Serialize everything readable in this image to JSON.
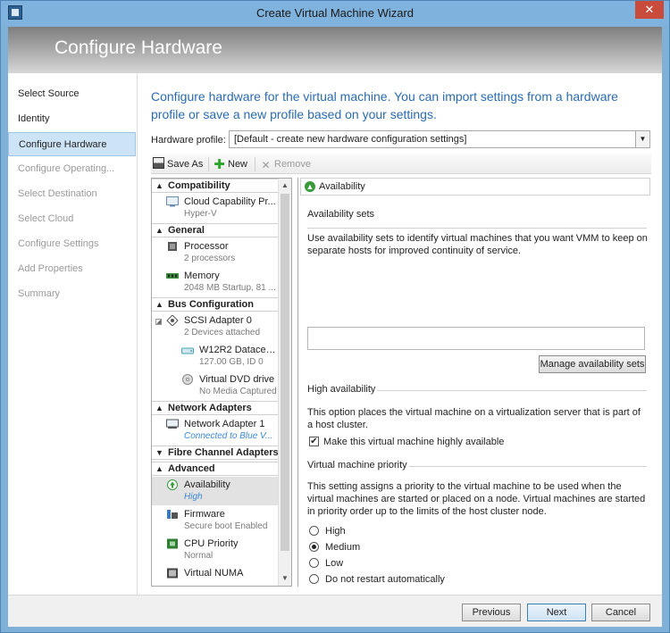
{
  "window": {
    "title": "Create Virtual Machine Wizard",
    "close_glyph": "✕"
  },
  "banner": {
    "heading": "Configure Hardware"
  },
  "steps": [
    {
      "label": "Select Source",
      "state": "normal"
    },
    {
      "label": "Identity",
      "state": "normal"
    },
    {
      "label": "Configure Hardware",
      "state": "active"
    },
    {
      "label": "Configure Operating...",
      "state": "disabled"
    },
    {
      "label": "Select Destination",
      "state": "disabled"
    },
    {
      "label": "Select Cloud",
      "state": "disabled"
    },
    {
      "label": "Configure Settings",
      "state": "disabled"
    },
    {
      "label": "Add Properties",
      "state": "disabled"
    },
    {
      "label": "Summary",
      "state": "disabled"
    }
  ],
  "intro": "Configure hardware for the virtual machine. You can import settings from a hardware profile or save a new profile based on your settings.",
  "hardware_profile": {
    "label": "Hardware profile:",
    "value": "[Default - create new hardware configuration settings]"
  },
  "toolbar": {
    "save_as": "Save As",
    "new": "New",
    "remove": "Remove"
  },
  "tree": {
    "categories": {
      "compatibility": "Compatibility",
      "general": "General",
      "bus": "Bus Configuration",
      "network": "Network Adapters",
      "fibre": "Fibre Channel Adapters",
      "advanced": "Advanced"
    },
    "cloud": {
      "label": "Cloud Capability Pr...",
      "sub": "Hyper-V"
    },
    "processor": {
      "label": "Processor",
      "sub": "2 processors"
    },
    "memory": {
      "label": "Memory",
      "sub": "2048 MB Startup, 81 ..."
    },
    "scsi": {
      "label": "SCSI Adapter 0",
      "sub": "2 Devices attached"
    },
    "disk": {
      "label": "W12R2 Datacent...",
      "sub": "127.00 GB, ID 0"
    },
    "dvd": {
      "label": "Virtual DVD drive",
      "sub": "No Media Captured"
    },
    "nic": {
      "label": "Network Adapter 1",
      "sub": "Connected to Blue V..."
    },
    "availability": {
      "label": "Availability",
      "sub": "High"
    },
    "firmware": {
      "label": "Firmware",
      "sub": "Secure boot Enabled"
    },
    "cpu_priority": {
      "label": "CPU Priority",
      "sub": "Normal"
    },
    "numa": {
      "label": "Virtual NUMA"
    }
  },
  "details": {
    "header": "Availability",
    "sets_title": "Availability sets",
    "sets_text": "Use availability sets to identify virtual machines that you want VMM to keep on separate hosts for improved continuity of service.",
    "manage_button": "Manage availability sets",
    "ha_title": "High availability",
    "ha_text": "This option places the virtual machine on a virtualization server that is part of a host cluster.",
    "ha_check_label": "Make this virtual machine highly available",
    "ha_checked": true,
    "priority_title": "Virtual machine priority",
    "priority_text": "This setting assigns a priority to the virtual machine to be used when the virtual machines are started or placed on a node. Virtual machines are started in priority order up to the limits of the host cluster node.",
    "priority_options": [
      "High",
      "Medium",
      "Low",
      "Do not restart automatically"
    ],
    "priority_selected": "Medium"
  },
  "footer": {
    "previous": "Previous",
    "next": "Next",
    "cancel": "Cancel"
  }
}
